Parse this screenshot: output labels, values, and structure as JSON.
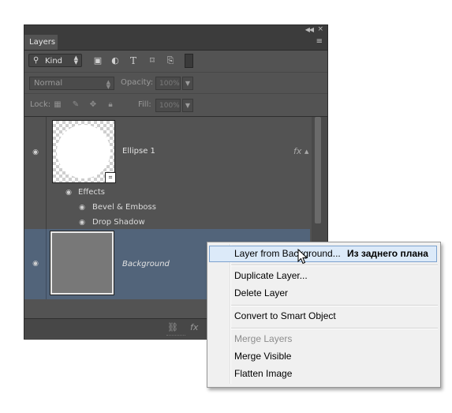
{
  "panel": {
    "tab_label": "Layers",
    "panel_menu_glyph": "≡",
    "filter": {
      "kind_label": "Kind",
      "icons": [
        "image-filter-icon",
        "adjustment-filter-icon",
        "type-filter-icon",
        "shape-filter-icon",
        "smart-object-filter-icon",
        "filter-toggle-icon"
      ]
    },
    "blend": {
      "mode": "Normal",
      "opacity_label": "Opacity:",
      "opacity_value": "100%"
    },
    "lock": {
      "label": "Lock:",
      "fill_label": "Fill:",
      "fill_value": "100%",
      "icons": [
        "lock-transparent-icon",
        "lock-image-icon",
        "lock-position-icon",
        "lock-all-icon"
      ]
    },
    "layers": [
      {
        "name": "Ellipse 1",
        "fx": "fx",
        "effects_label": "Effects",
        "effects": [
          "Bevel & Emboss",
          "Drop Shadow"
        ]
      },
      {
        "name": "Background",
        "selected": true
      }
    ],
    "footer_icons": [
      "link-icon",
      "fx-icon"
    ]
  },
  "context_menu": {
    "items": [
      {
        "label": "Layer from Background...",
        "highlighted": true,
        "annotation": "Из заднего плана"
      },
      {
        "label": "Duplicate Layer..."
      },
      {
        "label": "Delete Layer"
      },
      {
        "label": "Convert to Smart Object"
      },
      {
        "label": "Merge Layers",
        "disabled": true
      },
      {
        "label": "Merge Visible"
      },
      {
        "label": "Flatten Image"
      }
    ]
  }
}
